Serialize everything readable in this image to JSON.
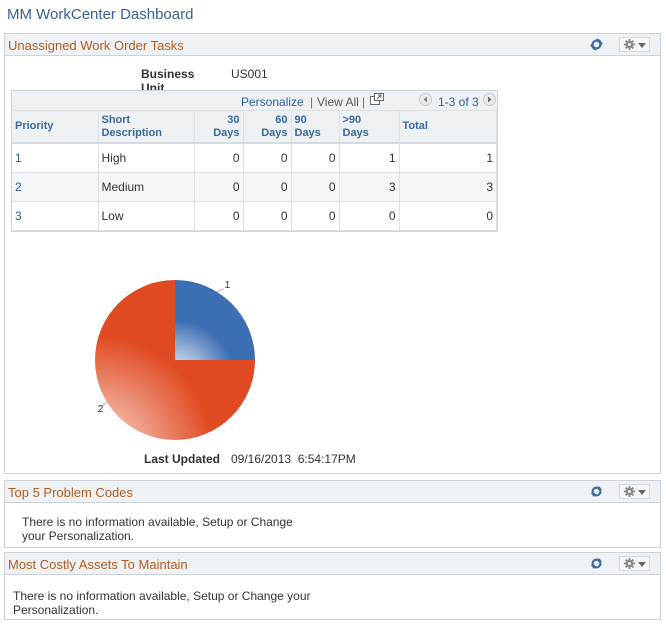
{
  "page": {
    "title": "MM WorkCenter Dashboard"
  },
  "pagelets": [
    {
      "title": "Unassigned Work Order Tasks",
      "business_unit_label": "Business Unit",
      "business_unit_value": "US001",
      "grid": {
        "personalize": "Personalize",
        "separator": "|",
        "view_all": "View All",
        "range": "1-3 of 3",
        "columns": [
          "Priority",
          "Short Description",
          "30 Days",
          "60 Days",
          "90 Days",
          ">90 Days",
          "Total"
        ],
        "rows": [
          {
            "priority": "1",
            "desc": "High",
            "d30": "0",
            "d60": "0",
            "d90": "0",
            "gt90": "1",
            "total": "1"
          },
          {
            "priority": "2",
            "desc": "Medium",
            "d30": "0",
            "d60": "0",
            "d90": "0",
            "gt90": "3",
            "total": "3"
          },
          {
            "priority": "3",
            "desc": "Low",
            "d30": "0",
            "d60": "0",
            "d90": "0",
            "gt90": "0",
            "total": "0"
          }
        ]
      },
      "last_updated_label": "Last Updated",
      "last_updated_value": "09/16/2013  6:54:17PM"
    },
    {
      "title": "Top 5 Problem Codes",
      "message_line1": "There is no information available, Setup or Change",
      "message_line2": "your Personalization."
    },
    {
      "title": "Most Costly Assets To Maintain",
      "message_line1": "There is no information available, Setup or Change your",
      "message_line2": "Personalization."
    }
  ],
  "icons": {
    "refresh": "refresh-icon",
    "actions": "gear-icon",
    "dropdown": "caret-down-icon",
    "new_window": "new-window-icon",
    "prev": "prev-icon",
    "next": "next-icon"
  },
  "colors": {
    "title": "#3a5f92",
    "pagelet_title": "#b35c1e",
    "link": "#2d5f9a",
    "pie_1": "#3c6eb4",
    "pie_2": "#e04a22"
  },
  "chart_data": {
    "type": "pie",
    "title": "",
    "categories": [
      "1",
      "2"
    ],
    "values": [
      1,
      3
    ],
    "labels": [
      "1",
      "2"
    ],
    "colors": [
      "#3c6eb4",
      "#e04a22"
    ]
  }
}
